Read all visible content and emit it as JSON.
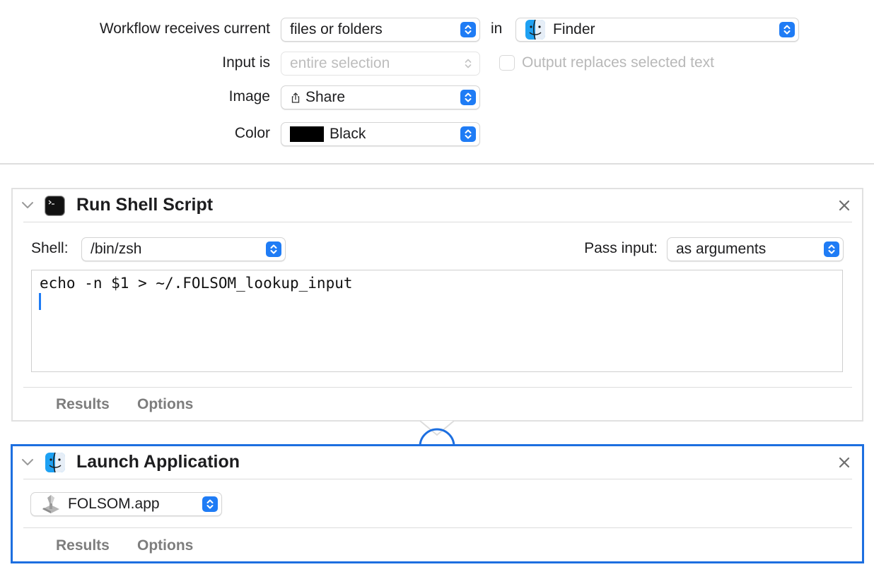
{
  "header": {
    "receives_label": "Workflow receives current",
    "receives_value": "files or folders",
    "in_label": "in",
    "app_value": "Finder",
    "input_label": "Input is",
    "input_value": "entire selection",
    "output_replaces_label": "Output replaces selected text",
    "output_replaces_checked": false,
    "image_label": "Image",
    "image_value": "Share",
    "color_label": "Color",
    "color_value": "Black",
    "color_swatch": "#000000"
  },
  "actions": [
    {
      "title": "Run Shell Script",
      "icon": "terminal-icon",
      "shell_label": "Shell:",
      "shell_value": "/bin/zsh",
      "pass_input_label": "Pass input:",
      "pass_input_value": "as arguments",
      "script": "echo -n $1 > ~/.FOLSOM_lookup_input",
      "tabs": [
        "Results",
        "Options"
      ]
    },
    {
      "title": "Launch Application",
      "icon": "finder-icon",
      "app_value": "FOLSOM.app",
      "app_icon": "application-icon",
      "tabs": [
        "Results",
        "Options"
      ]
    }
  ],
  "colors": {
    "accent": "#1f7cf5",
    "selected_border": "#1d6fe0"
  }
}
